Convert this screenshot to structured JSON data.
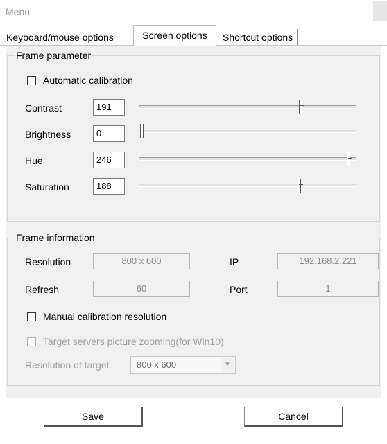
{
  "window": {
    "title": "Menu"
  },
  "tabs": [
    "Keyboard/mouse options",
    "Screen options",
    "Shortcut options"
  ],
  "frame_parameter": {
    "label": "Frame parameter",
    "auto_calibration": {
      "label": "Automatic calibration",
      "checked": false
    },
    "rows": [
      {
        "label": "Contrast",
        "value": "191",
        "level": 0.75
      },
      {
        "label": "Brightness",
        "value": "0",
        "level": 0.0
      },
      {
        "label": "Hue",
        "value": "246",
        "level": 0.96
      },
      {
        "label": "Saturation",
        "value": "188",
        "level": 0.74
      }
    ]
  },
  "frame_information": {
    "label": "Frame information",
    "resolution_label": "Resolution",
    "resolution_value": "800 x 600",
    "ip_label": "IP",
    "ip_value": "192.168.2.221",
    "refresh_label": "Refresh",
    "refresh_value": "60",
    "port_label": "Port",
    "port_value": "1",
    "manual_calibration": {
      "label": "Manual calibration resolution",
      "checked": false
    },
    "target_zoom": {
      "label": "Target servers picture zooming(for Win10)",
      "checked": false
    },
    "target_resolution_label": "Resolution of target",
    "target_resolution_value": "800 x 600"
  },
  "buttons": {
    "save": "Save",
    "cancel": "Cancel"
  }
}
